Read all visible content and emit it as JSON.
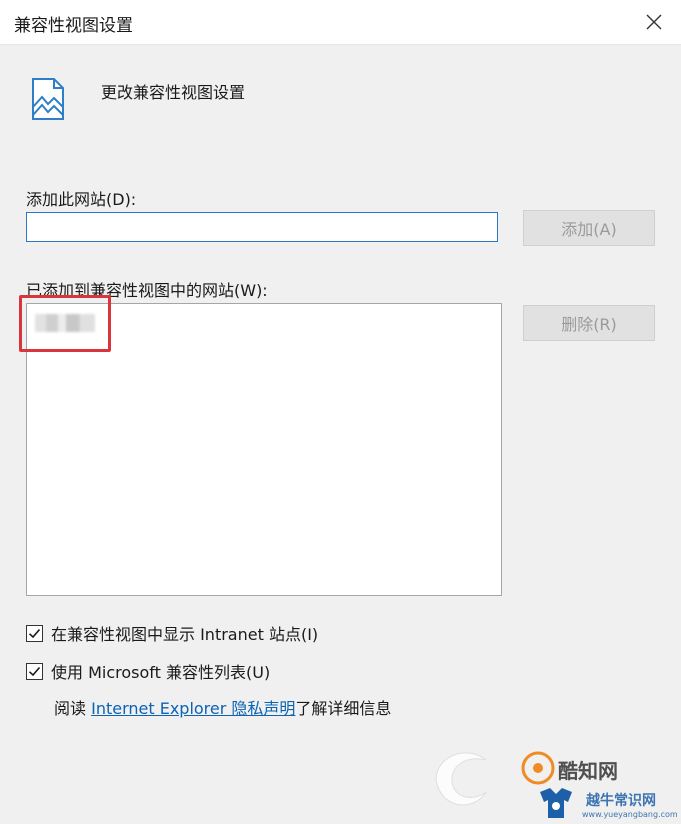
{
  "window": {
    "title": "兼容性视图设置"
  },
  "header": {
    "text": "更改兼容性视图设置"
  },
  "add_site": {
    "label": "添加此网站(D):",
    "value": "",
    "button": "添加(A)"
  },
  "site_list": {
    "label": "已添加到兼容性视图中的网站(W):",
    "items": [
      "*** .***"
    ],
    "delete_button": "删除(R)"
  },
  "options": {
    "intranet": {
      "label": "在兼容性视图中显示 Intranet 站点(I)",
      "checked": true
    },
    "ms_list": {
      "label": "使用 Microsoft 兼容性列表(U)",
      "checked": true
    }
  },
  "info": {
    "prefix": "阅读 ",
    "link": "Internet Explorer 隐私声明",
    "suffix": "了解详细信息"
  },
  "watermark": {
    "text1": "酷知网",
    "text2": "越牛常识网",
    "url": "www.yueyangbang.com"
  },
  "colors": {
    "link": "#0b63b3",
    "highlight": "#d9353d",
    "input_border": "#2b78c4"
  }
}
